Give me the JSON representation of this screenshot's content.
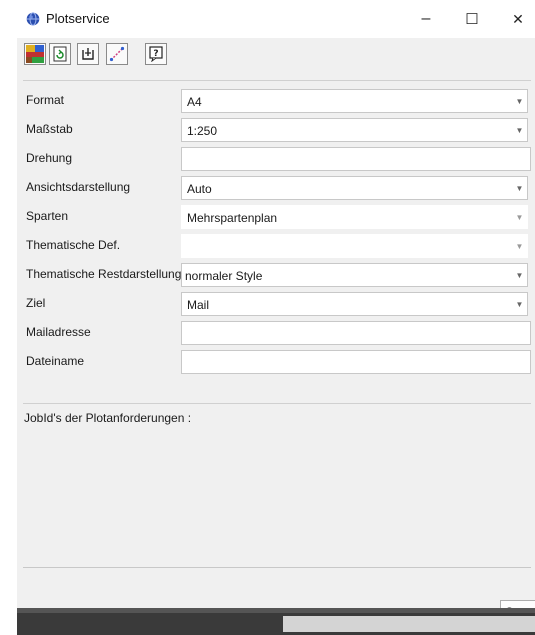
{
  "window": {
    "title": "Plotservice",
    "app_icon": "globe-icon",
    "controls": {
      "minimize": "–",
      "maximize": "☐",
      "close": "✕"
    }
  },
  "toolbar": {
    "buttons": [
      {
        "name": "map-icon"
      },
      {
        "name": "refresh-icon"
      },
      {
        "name": "frame-icon"
      },
      {
        "name": "measure-line-icon"
      },
      {
        "name": "help-icon"
      }
    ]
  },
  "form": {
    "rows": [
      {
        "label": "Format",
        "value": "A4",
        "type": "combo"
      },
      {
        "label": "Maßstab",
        "value": "1:250",
        "type": "combo"
      },
      {
        "label": "Drehung",
        "value": "",
        "type": "input"
      },
      {
        "label": "Ansichtsdarstellung",
        "value": "Auto",
        "type": "combo"
      },
      {
        "label": "Sparten",
        "value": "Mehrspartenplan",
        "type": "combo-flat"
      },
      {
        "label": "Thematische Def.",
        "value": "",
        "type": "combo"
      },
      {
        "label": "Thematische Restdarstellung",
        "value": "normaler Style",
        "type": "combo"
      },
      {
        "label": "Ziel",
        "value": "Mail",
        "type": "combo"
      },
      {
        "label": "Mailadresse",
        "value": "",
        "type": "input"
      },
      {
        "label": "Dateiname",
        "value": "",
        "type": "input"
      }
    ]
  },
  "output": {
    "label": "JobId's der Plotanforderungen :"
  },
  "actions": {
    "start_label": "Start"
  },
  "colors": {
    "titlebar": "#ffffff",
    "window_bg": "#f0f0f0",
    "statusbar": "#3a3a3a"
  }
}
